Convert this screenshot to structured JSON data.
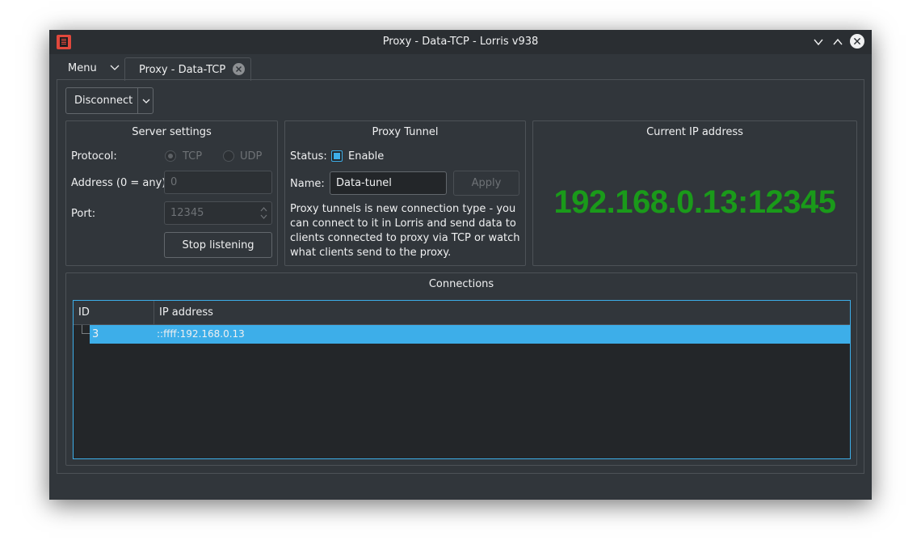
{
  "window": {
    "title": "Proxy - Data-TCP - Lorris v938"
  },
  "tabs": {
    "menu_label": "Menu",
    "active_tab_label": "Proxy - Data-TCP"
  },
  "toolbar": {
    "disconnect_label": "Disconnect"
  },
  "server_settings": {
    "title": "Server settings",
    "protocol_label": "Protocol:",
    "tcp_label": "TCP",
    "udp_label": "UDP",
    "address_label": "Address (0 = any):",
    "address_value": "0",
    "port_label": "Port:",
    "port_value": "12345",
    "stop_button": "Stop listening"
  },
  "proxy_tunnel": {
    "title": "Proxy Tunnel",
    "status_label": "Status:",
    "enable_label": "Enable",
    "name_label": "Name:",
    "name_value": "Data-tunel",
    "apply_button": "Apply",
    "description": "Proxy tunnels is new connection type - you can connect to it in Lorris and send data to clients connected to proxy via TCP or watch what clients send to the proxy."
  },
  "current_ip": {
    "title": "Current IP address",
    "value": "192.168.0.13:12345",
    "color": "#1a9a1a"
  },
  "connections": {
    "title": "Connections",
    "columns": [
      "ID",
      "IP address"
    ],
    "rows": [
      {
        "id": "3",
        "ip": "::ffff:192.168.0.13"
      }
    ]
  },
  "colors": {
    "accent": "#3daee9",
    "background": "#31363b",
    "titlebar": "#2a2e32",
    "app_icon": "#e0483c"
  }
}
